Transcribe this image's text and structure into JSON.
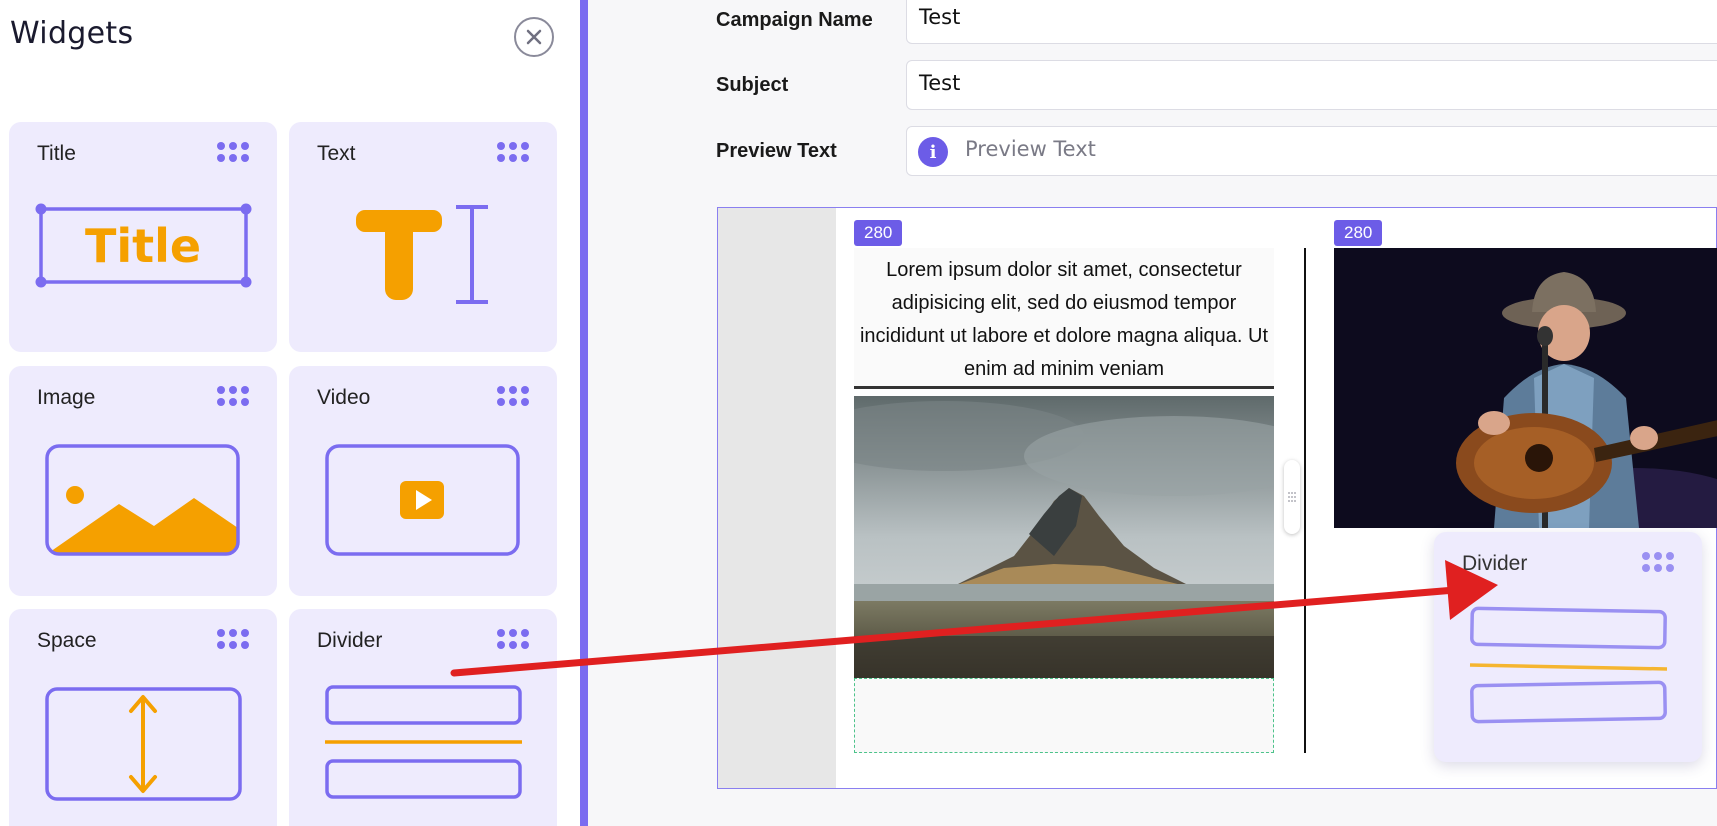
{
  "panel": {
    "title": "Widgets",
    "close_icon": "close-circle-icon",
    "widgets": [
      {
        "label": "Title",
        "art_text": "Title",
        "icon": "title-widget-icon"
      },
      {
        "label": "Text",
        "icon": "text-widget-icon"
      },
      {
        "label": "Image",
        "icon": "image-widget-icon"
      },
      {
        "label": "Video",
        "icon": "video-widget-icon"
      },
      {
        "label": "Space",
        "icon": "space-widget-icon"
      },
      {
        "label": "Divider",
        "icon": "divider-widget-icon"
      }
    ]
  },
  "form": {
    "campaign_name_label": "Campaign Name",
    "campaign_name_value": "Test",
    "subject_label": "Subject",
    "subject_value": "Test",
    "preview_text_label": "Preview Text",
    "preview_text_placeholder": "Preview Text"
  },
  "canvas": {
    "left_column_width_badge": "280",
    "right_column_width_badge": "280",
    "body_text": "Lorem ipsum dolor sit amet, consectetur adipisicing elit, sed do eiusmod tempor incididunt ut labore et dolore magna aliqua. Ut enim ad minim veniam"
  },
  "drag_preview": {
    "label": "Divider"
  },
  "colors": {
    "accent": "#7b6cf0",
    "orange": "#f5a000",
    "tile_bg": "#eeebfd",
    "arrow": "#e02020"
  }
}
